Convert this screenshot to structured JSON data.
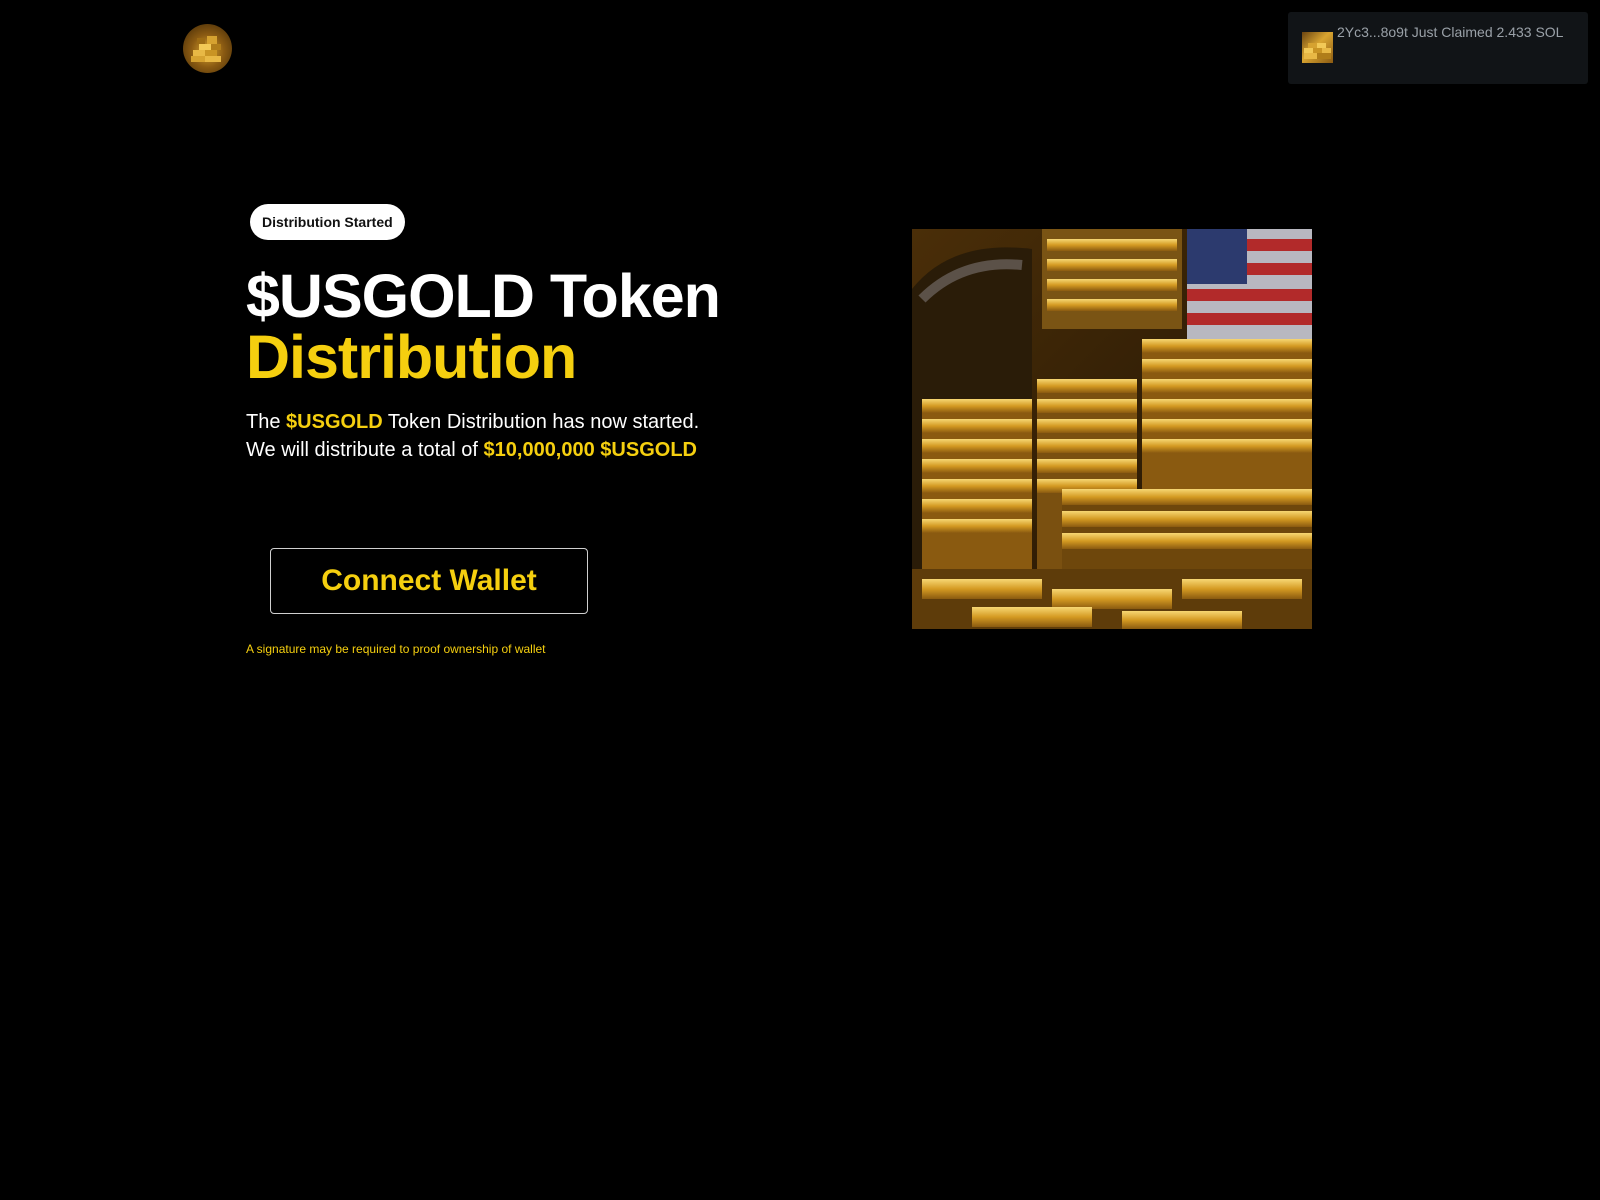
{
  "header": {
    "logo_icon": "gold-bars-logo-icon"
  },
  "toast": {
    "icon": "gold-bars-thumbnail-icon",
    "message": "2Yc3...8o9t Just Claimed 2.433 SOL"
  },
  "hero": {
    "badge": "Distribution Started",
    "title_line1": "$USGOLD Token",
    "title_line2": "Distribution",
    "desc_prefix": "The ",
    "desc_token": "$USGOLD",
    "desc_suffix": " Token Distribution has now started.",
    "desc_line2_prefix": "We will distribute a total of ",
    "desc_amount": "$10,000,000 $USGOLD",
    "connect_label": "Connect Wallet",
    "note": "A signature may be required to proof ownership of wallet",
    "image": "gold-vault-american-flag-image"
  },
  "colors": {
    "background": "#000000",
    "accent": "#f5cf0f",
    "text": "#ffffff",
    "toast_bg": "#111417"
  }
}
